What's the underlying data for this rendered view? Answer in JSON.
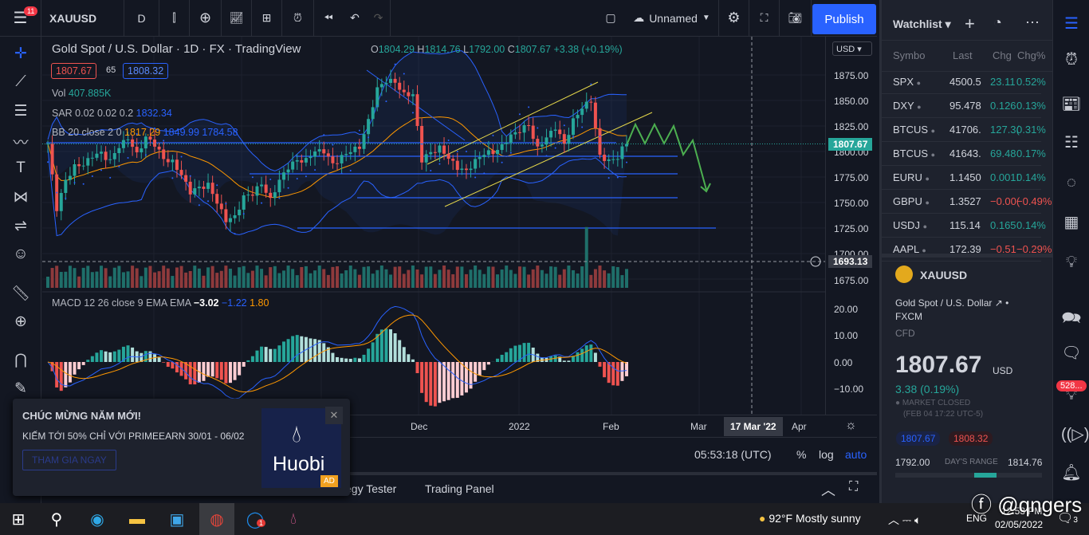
{
  "topbar": {
    "symbol": "XAUUSD",
    "interval": "D",
    "layout_name": "Unnamed",
    "publish": "Publish",
    "icons": [
      "menu-icon",
      "bar-style-icon",
      "add-indicator-icon",
      "indicators-icon",
      "templates-icon",
      "alert-icon",
      "replay-icon",
      "undo-icon",
      "redo-icon",
      "layout-icon",
      "settings-icon",
      "fullscreen-icon",
      "camera-icon"
    ],
    "notification_count": "11"
  },
  "legend": {
    "title": "Gold Spot / U.S. Dollar",
    "interval": "1D",
    "exchange": "FX",
    "source": "TradingView",
    "o_label": "O",
    "o": "1804.29",
    "h_label": "H",
    "h": "1814.76",
    "l_label": "L",
    "l": "1792.00",
    "c_label": "C",
    "c": "1807.67",
    "change": "+3.38 (+0.19%)",
    "sell": "1807.67",
    "spread": "65",
    "buy": "1808.32",
    "vol_label": "Vol",
    "vol": "407.885K",
    "sar_label": "SAR 0.02 0.02 0.2",
    "sar": "1832.34",
    "bb_label": "BB 20 close 2 0",
    "bb_basis": "1817.29",
    "bb_upper": "1849.99",
    "bb_lower": "1784.58",
    "macd_label": "MACD 12 26 close 9 EMA EMA",
    "macd_hist": "−3.02",
    "macd": "−1.22",
    "macd_signal": "1.80"
  },
  "price_axis": {
    "currency": "USD",
    "ticks": [
      "1875.00",
      "1850.00",
      "1825.00",
      "1800.00",
      "1775.00",
      "1750.00",
      "1725.00",
      "1700.00",
      "1675.00"
    ],
    "last_price": "1807.67",
    "crosshair_price": "1693.13",
    "macd_ticks": [
      "20.00",
      "10.00",
      "0.00",
      "−10.00"
    ]
  },
  "time_axis": {
    "labels": [
      "Dec",
      "2022",
      "Feb",
      "Mar",
      "Apr"
    ],
    "crosshair_date": "17 Mar '22"
  },
  "bottom_toolbar": {
    "clock": "05:53:18 (UTC)",
    "percent": "%",
    "log": "log",
    "auto": "auto"
  },
  "bottom_tabs": [
    "egy Tester",
    "Trading Panel"
  ],
  "colors": {
    "up": "#26a69a",
    "down": "#ef5350",
    "accent": "#2962ff",
    "bb": "#2962ff",
    "basis": "#ff9800",
    "channel": "#e6d84a",
    "projection": "#4caf50"
  },
  "chart_data": {
    "type": "candlestick",
    "closes": [
      1805,
      1745,
      1770,
      1790,
      1785,
      1795,
      1800,
      1792,
      1805,
      1810,
      1802,
      1812,
      1808,
      1790,
      1795,
      1775,
      1760,
      1765,
      1770,
      1750,
      1730,
      1740,
      1755,
      1760,
      1765,
      1758,
      1770,
      1785,
      1790,
      1795,
      1800,
      1798,
      1790,
      1795,
      1802,
      1800,
      1835,
      1860,
      1870,
      1865,
      1860,
      1855,
      1790,
      1800,
      1805,
      1795,
      1780,
      1785,
      1790,
      1800,
      1795,
      1810,
      1815,
      1820,
      1825,
      1805,
      1815,
      1820,
      1810,
      1830,
      1845,
      1845,
      1800,
      1790,
      1795,
      1807.67
    ]
  },
  "watchlist": {
    "title": "Watchlist",
    "headers": [
      "Symbo",
      "Last",
      "Chg",
      "Chg%"
    ],
    "rows": [
      {
        "sym": "SPX",
        "last": "4500.5",
        "chg": "23.11",
        "pct": "0.52%",
        "dir": "up"
      },
      {
        "sym": "DXY",
        "last": "95.478",
        "chg": "0.126",
        "pct": "0.13%",
        "dir": "up"
      },
      {
        "sym": "BTCUS",
        "last": "41706.",
        "chg": "127.3(",
        "pct": "0.31%",
        "dir": "up"
      },
      {
        "sym": "BTCUS",
        "last": "41643.",
        "chg": "69.48",
        "pct": "0.17%",
        "dir": "up"
      },
      {
        "sym": "EURU",
        "last": "1.1450",
        "chg": "0.001!",
        "pct": "0.14%",
        "dir": "up"
      },
      {
        "sym": "GBPU",
        "last": "1.3527",
        "chg": "−0.00(",
        "pct": "−0.49%",
        "dir": "down"
      },
      {
        "sym": "USDJ",
        "last": "115.14",
        "chg": "0.165",
        "pct": "0.14%",
        "dir": "up"
      },
      {
        "sym": "AAPL",
        "last": "172.39",
        "chg": "−0.51",
        "pct": "−0.29%",
        "dir": "down"
      }
    ]
  },
  "details": {
    "symbol": "XAUUSD",
    "name": "Gold Spot / U.S. Dollar",
    "exchange": "FXCM",
    "type": "CFD",
    "price": "1807.67",
    "currency": "USD",
    "change": "3.38 (0.19%)",
    "status": "MARKET CLOSED",
    "status_time": "(FEB 04 17:22 UTC-5)",
    "bid": "1807.67",
    "ask": "1808.32",
    "low": "1792.00",
    "range_label": "DAY'S RANGE",
    "high": "1814.76",
    "range_position": 0.69
  },
  "right_icons": {
    "badge": "528..."
  },
  "ad": {
    "title": "CHÚC MỪNG NĂM MỚI!",
    "text": "KIẾM TỚI 50% CHỈ VỚI PRIMEEARN 30/01 - 06/02",
    "button": "THAM GIA NGAY",
    "brand": "Huobi",
    "tag": "AD"
  },
  "taskbar": {
    "weather": "92°F  Mostly sunny",
    "lang": "ENG",
    "time": "12:53 PM",
    "date": "02/05/2022",
    "zalo_badge": "1",
    "notif_count": "3",
    "watermark": "@qngers"
  }
}
